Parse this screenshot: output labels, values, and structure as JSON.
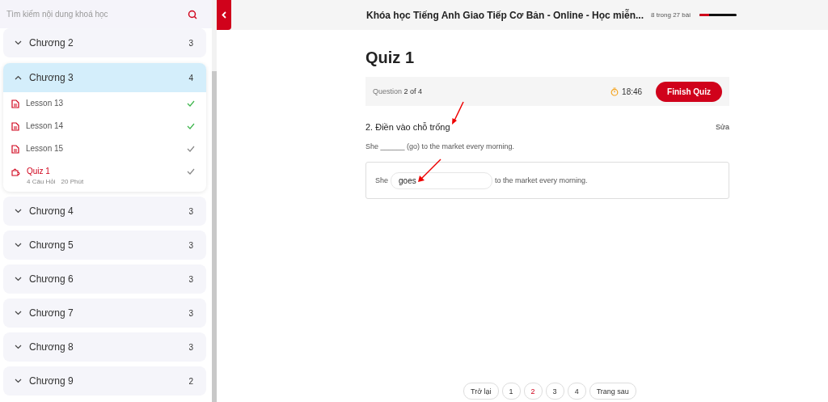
{
  "sidebar": {
    "search": {
      "placeholder": "Tìm kiếm nội dung khoá học"
    },
    "chapters": [
      {
        "title": "Chương 2",
        "count": "3",
        "expanded": false
      },
      {
        "title": "Chương 3",
        "count": "4",
        "expanded": true,
        "lessons": [
          {
            "kind": "lesson",
            "title": "Lesson 13",
            "completed": true,
            "selected": false
          },
          {
            "kind": "lesson",
            "title": "Lesson 14",
            "completed": true,
            "selected": false
          },
          {
            "kind": "lesson",
            "title": "Lesson 15",
            "completed": false,
            "selected": false
          },
          {
            "kind": "quiz",
            "title": "Quiz 1",
            "completed": false,
            "selected": true,
            "meta": [
              "4 Câu Hỏi",
              "20 Phút"
            ]
          }
        ]
      },
      {
        "title": "Chương 4",
        "count": "3",
        "expanded": false
      },
      {
        "title": "Chương 5",
        "count": "3",
        "expanded": false
      },
      {
        "title": "Chương 6",
        "count": "3",
        "expanded": false
      },
      {
        "title": "Chương 7",
        "count": "3",
        "expanded": false
      },
      {
        "title": "Chương 8",
        "count": "3",
        "expanded": false
      },
      {
        "title": "Chương 9",
        "count": "2",
        "expanded": false
      }
    ]
  },
  "header": {
    "course_title": "Khóa học Tiếng Anh Giao Tiếp Cơ Bản - Online - Học miễn...",
    "progress_text": "8 trong 27 bài",
    "level": 0.27
  },
  "quiz": {
    "title": "Quiz 1",
    "question_label": "Question",
    "question_position": "2 of 4",
    "timer": "18:46",
    "finish_button": "Finish Quiz",
    "question_title": "2. Điền vào chỗ trống",
    "edit_link": "Sửa",
    "prompt": "She ______ (go) to the market every morning.",
    "answer": {
      "before": "She",
      "value": "goes",
      "after": "to the market every morning."
    }
  },
  "pagination": {
    "prev": "Trở lại",
    "next": "Trang sau",
    "pages": [
      {
        "label": "1",
        "selected": false
      },
      {
        "label": "2",
        "selected": true
      },
      {
        "label": "3",
        "selected": false
      },
      {
        "label": "4",
        "selected": false
      }
    ]
  }
}
